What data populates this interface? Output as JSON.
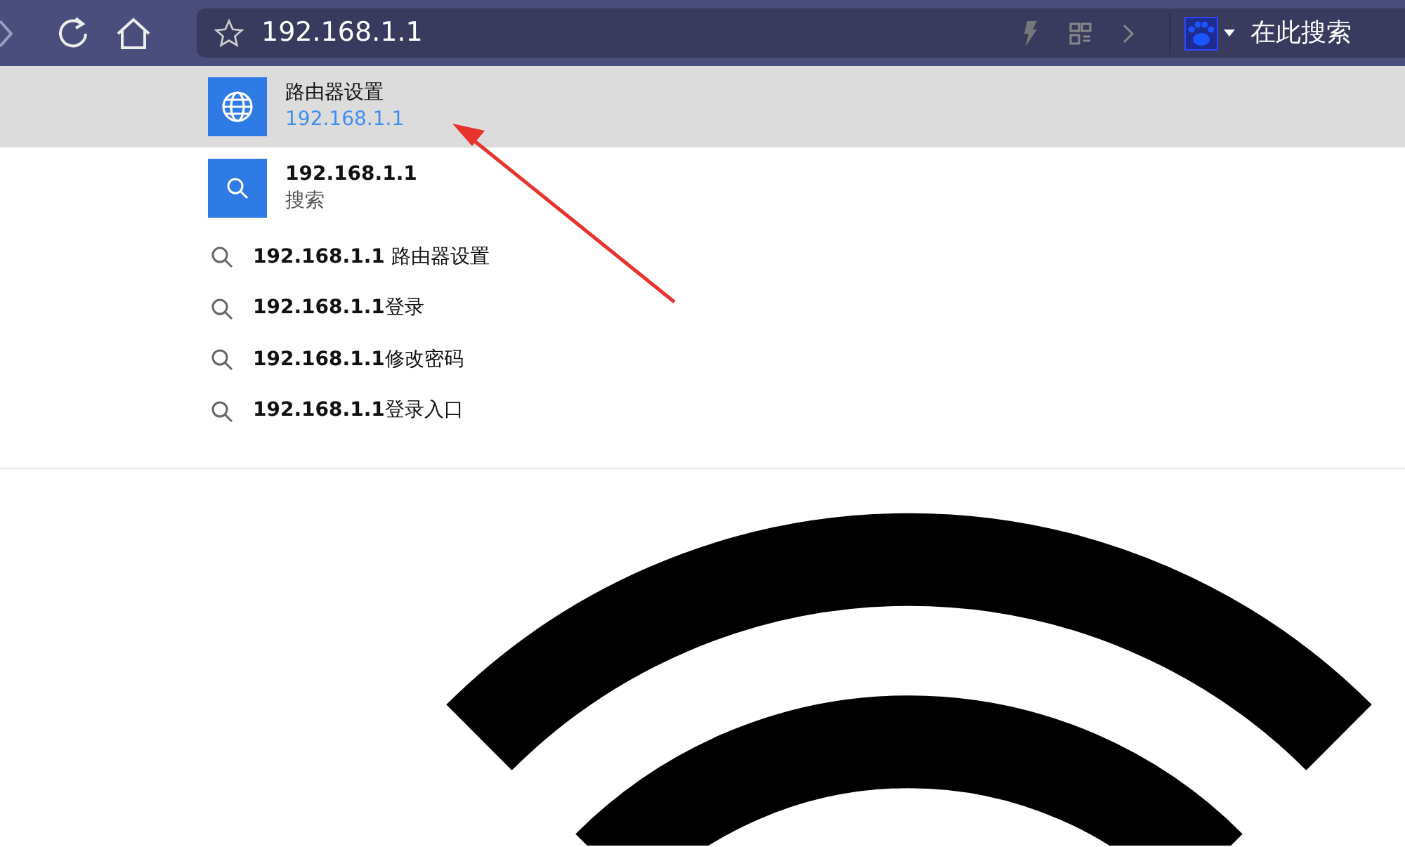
{
  "toolbar": {
    "address": {
      "value": "192.168.1.1"
    },
    "search": {
      "placeholder": "在此搜索"
    }
  },
  "suggestions": [
    {
      "kind": "site",
      "title": "路由器设置",
      "subtitle": "192.168.1.1",
      "selected": true
    },
    {
      "kind": "search",
      "title": "192.168.1.1",
      "subtitle": "搜索",
      "selected": false
    },
    {
      "kind": "query",
      "text": "**192.168.1.1** 路由器设置",
      "selected": false
    },
    {
      "kind": "query",
      "text": "**192.168.1.1**登录",
      "selected": false
    },
    {
      "kind": "query",
      "text": "**192.168.1.1**修改密码",
      "selected": false
    },
    {
      "kind": "query",
      "text": "**192.168.1.1**登录入口",
      "selected": false
    }
  ]
}
